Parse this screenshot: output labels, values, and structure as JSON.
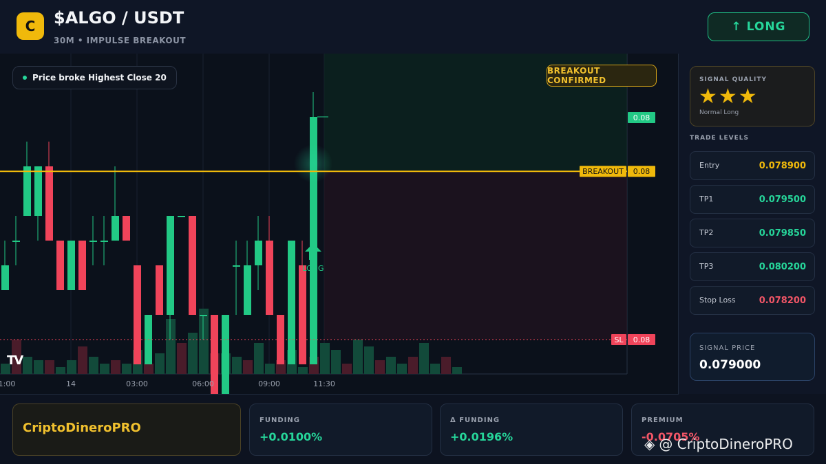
{
  "header": {
    "logo_letter": "C",
    "pair": "$ALGO / USDT",
    "subtitle": "30M • IMPULSE BREAKOUT",
    "direction_button": "↑ LONG"
  },
  "chart": {
    "info_pill": "Price broke Highest Close 20",
    "confirmed_badge": "BREAKOUT CONFIRMED",
    "long_marker": "LONG",
    "tv_logo": "TV"
  },
  "chart_data": {
    "type": "candlestick",
    "price_labels": {
      "current": "0.08",
      "breakout_label": "BREAKOUT",
      "breakout": "0.08",
      "sl_label": "SL",
      "sl": "0.08"
    },
    "x_ticks": [
      "1:00",
      "14",
      "03:00",
      "06:00",
      "09:00",
      "11:30"
    ],
    "levels": {
      "breakout": 0.07888,
      "stop_loss": 0.0782
    },
    "candles": [
      {
        "o": 0.0784,
        "h": 0.0786,
        "l": 0.0784,
        "c": 0.0785
      },
      {
        "o": 0.0786,
        "h": 0.0787,
        "l": 0.0785,
        "c": 0.0786
      },
      {
        "o": 0.0787,
        "h": 0.079,
        "l": 0.0787,
        "c": 0.0789
      },
      {
        "o": 0.0787,
        "h": 0.0789,
        "l": 0.0786,
        "c": 0.0789
      },
      {
        "o": 0.0789,
        "h": 0.079,
        "l": 0.0786,
        "c": 0.0786
      },
      {
        "o": 0.0786,
        "h": 0.0786,
        "l": 0.0784,
        "c": 0.0784
      },
      {
        "o": 0.0784,
        "h": 0.0786,
        "l": 0.0784,
        "c": 0.0786
      },
      {
        "o": 0.0786,
        "h": 0.0786,
        "l": 0.0784,
        "c": 0.0784
      },
      {
        "o": 0.0786,
        "h": 0.0787,
        "l": 0.0785,
        "c": 0.0786
      },
      {
        "o": 0.0786,
        "h": 0.0787,
        "l": 0.0785,
        "c": 0.0786
      },
      {
        "o": 0.0786,
        "h": 0.0789,
        "l": 0.0786,
        "c": 0.0787
      },
      {
        "o": 0.0787,
        "h": 0.0787,
        "l": 0.0786,
        "c": 0.0786
      },
      {
        "o": 0.0785,
        "h": 0.0785,
        "l": 0.0781,
        "c": 0.0781
      },
      {
        "o": 0.0781,
        "h": 0.0783,
        "l": 0.0781,
        "c": 0.0783
      },
      {
        "o": 0.0785,
        "h": 0.0785,
        "l": 0.0783,
        "c": 0.0783
      },
      {
        "o": 0.0783,
        "h": 0.0787,
        "l": 0.0782,
        "c": 0.0787
      },
      {
        "o": 0.0787,
        "h": 0.0787,
        "l": 0.0787,
        "c": 0.0787
      },
      {
        "o": 0.0787,
        "h": 0.0787,
        "l": 0.0783,
        "c": 0.0783
      },
      {
        "o": 0.0783,
        "h": 0.0783,
        "l": 0.0782,
        "c": 0.0783
      },
      {
        "o": 0.0783,
        "h": 0.0783,
        "l": 0.0779,
        "c": 0.0779
      },
      {
        "o": 0.0779,
        "h": 0.0783,
        "l": 0.0779,
        "c": 0.0783
      },
      {
        "o": 0.0785,
        "h": 0.0786,
        "l": 0.0783,
        "c": 0.0785
      },
      {
        "o": 0.0783,
        "h": 0.0786,
        "l": 0.0783,
        "c": 0.0785
      },
      {
        "o": 0.0785,
        "h": 0.0787,
        "l": 0.0784,
        "c": 0.0786
      },
      {
        "o": 0.0786,
        "h": 0.0787,
        "l": 0.0783,
        "c": 0.0783
      },
      {
        "o": 0.0783,
        "h": 0.0783,
        "l": 0.0781,
        "c": 0.0781
      },
      {
        "o": 0.0781,
        "h": 0.0786,
        "l": 0.0781,
        "c": 0.0786
      },
      {
        "o": 0.0785,
        "h": 0.0786,
        "l": 0.0781,
        "c": 0.0781
      },
      {
        "o": 0.0781,
        "h": 0.0792,
        "l": 0.0781,
        "c": 0.0791
      }
    ],
    "volume": [
      3,
      10,
      5,
      4,
      4,
      2,
      4,
      8,
      5,
      3,
      4,
      3,
      7,
      3,
      6,
      16,
      9,
      12,
      19,
      6,
      6,
      5,
      4,
      9,
      3,
      4,
      7,
      2,
      5,
      9,
      7,
      3,
      10,
      8,
      4,
      5,
      3,
      5,
      9,
      3,
      5,
      2
    ]
  },
  "sidebar": {
    "quality_label": "SIGNAL QUALITY",
    "stars": "★★★",
    "quality_desc": "Normal Long",
    "trade_levels_title": "TRADE LEVELS",
    "levels": [
      {
        "name": "Entry",
        "value": "0.078900",
        "color": "#f0b90b"
      },
      {
        "name": "TP1",
        "value": "0.079500",
        "color": "#26d69a"
      },
      {
        "name": "TP2",
        "value": "0.079850",
        "color": "#26d69a"
      },
      {
        "name": "TP3",
        "value": "0.080200",
        "color": "#26d69a"
      },
      {
        "name": "Stop Loss",
        "value": "0.078200",
        "color": "#f05566"
      }
    ],
    "signal_price_label": "SIGNAL PRICE",
    "signal_price": "0.079000"
  },
  "footer": {
    "brand": "CriptoDineroPRO",
    "stats": [
      {
        "label": "FUNDING",
        "value": "+0.0100%",
        "color": "#26d69a"
      },
      {
        "label": "Δ FUNDING",
        "value": "+0.0196%",
        "color": "#26d69a"
      },
      {
        "label": "PREMIUM",
        "value": "-0.0705%",
        "color": "#f05566"
      }
    ],
    "watermark": "@ CriptoDineroPRO"
  },
  "colors": {
    "up": "#22c985",
    "down": "#f0445a",
    "accent": "#f0b90b",
    "background": "#0d1320"
  }
}
